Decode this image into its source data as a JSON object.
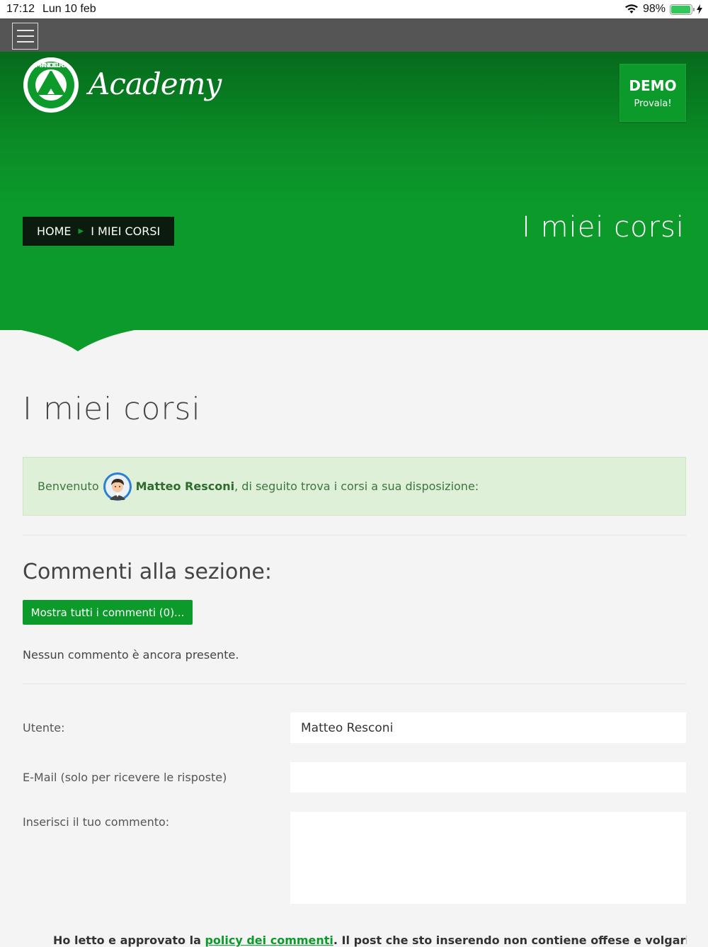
{
  "status_bar": {
    "time": "17:12",
    "date": "Lun 10 feb",
    "battery": "98%"
  },
  "header": {
    "brand_text": "Academy",
    "logo_text": "IMPIANTO SICURO",
    "demo_title": "DEMO",
    "demo_subtitle": "Provala!"
  },
  "breadcrumb": {
    "home": "HOME",
    "current": "I MIEI CORSI"
  },
  "hero": {
    "title": "I miei corsi"
  },
  "main": {
    "page_title": "I miei corsi",
    "welcome_prefix": "Benvenuto",
    "user_name": "Matteo Resconi",
    "welcome_suffix": ", di seguito trova i corsi a sua disposizione:"
  },
  "comments": {
    "title": "Commenti alla sezione:",
    "show_all_label": "Mostra tutti i commenti (0)...",
    "empty_text": "Nessun commento è ancora presente."
  },
  "form": {
    "user_label": "Utente:",
    "user_value": "Matteo Resconi",
    "email_label": "E-Mail (solo per ricevere le risposte)",
    "email_value": "",
    "comment_label": "Inserisci il tuo commento:",
    "comment_value": "",
    "policy_prefix": "Ho letto e approvato la ",
    "policy_link": "policy dei commenti",
    "policy_suffix": ". Il post che sto inserendo non contiene offese e volgarità, non"
  },
  "colors": {
    "brand_green": "#0c9a2b",
    "dark_bar": "#555555",
    "breadcrumb_bg": "#0b1c0e",
    "alert_bg": "#dff0d8"
  },
  "icons": [
    "menu-icon",
    "wifi-icon",
    "battery-icon",
    "charging-icon",
    "chevron-right-icon",
    "avatar"
  ]
}
